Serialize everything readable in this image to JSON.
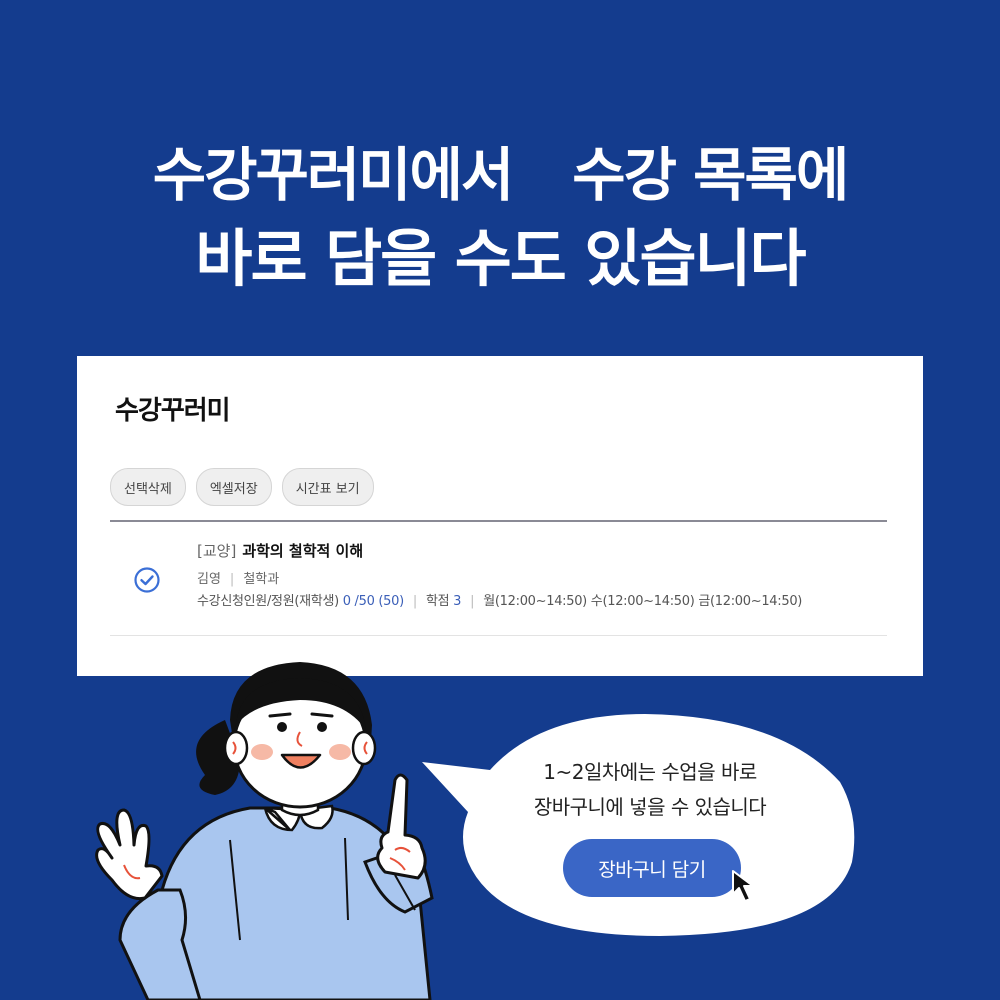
{
  "headline": {
    "line1_left": "수강꾸러미에서",
    "line1_right": "수강 목록에",
    "line2": "바로 담을 수도 있습니다"
  },
  "panel": {
    "title": "수강꾸러미",
    "toolbar": [
      "선택삭제",
      "엑셀저장",
      "시간표 보기"
    ],
    "course": {
      "category": "[교양]",
      "name": "과학의 철학적 이해",
      "professor": "김영",
      "department": "철학과",
      "enroll_label": "수강신청인원/정원(재학생)",
      "enroll_value": "0 /50 (50)",
      "credit_label": "학점",
      "credit_value": "3",
      "schedule": "월(12:00~14:50) 수(12:00~14:50) 금(12:00~14:50)",
      "selected": true
    }
  },
  "bubble": {
    "line1": "1~2일차에는 수업을 바로",
    "line2": "장바구니에 넣을 수 있습니다",
    "button": "장바구니 담기"
  },
  "colors": {
    "background": "#143c8e",
    "accent": "#3a66c6",
    "check": "#3b6fd6"
  },
  "icons": [
    "check-circle-icon",
    "mouse-pointer-icon"
  ]
}
